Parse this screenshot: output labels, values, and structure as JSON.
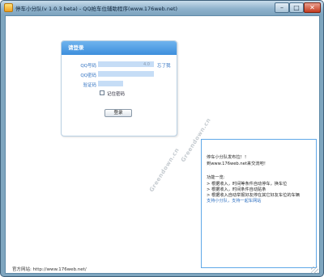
{
  "window": {
    "title": "停车小分队(v 1.0.3 beta) - QQ抢车位辅助程序(www.176web.net)",
    "controls": {
      "minimize": "–",
      "maximize": "□",
      "close": "✕"
    }
  },
  "login": {
    "header": "请登录",
    "qq_label": "QQ号码",
    "qq_hint": "4.0",
    "forgot": "忘了我",
    "password_label": "QQ密码",
    "code_label": "验证码",
    "remember_label": "记住密码",
    "remember_checked": false,
    "submit_label": "登录"
  },
  "watermark": {
    "text1": "Greendown.cn",
    "text2": "Greendown.cn"
  },
  "info": {
    "line1": "停车小分队发布拉！！",
    "line2": "到www.176web.net来交流吧！",
    "line3": "功能一览:",
    "line4": "> 根据收入，时间等条件自动停车，换车位",
    "line5": "> 根据收入，时间条件自动贴条",
    "line6": "> 根据收入自动举报好友停在其它好友车位的车辆",
    "link1": "支持小分队，支持一起车网站"
  },
  "footer": {
    "official_site": "官方网站: http://www.176web.net/"
  },
  "colors": {
    "title_bar": "#8fb2cc",
    "card_header": "#4a9be4",
    "input_fill": "#c6ddf6",
    "link": "#2d6fc0",
    "panel_border": "#5fa8e8"
  }
}
